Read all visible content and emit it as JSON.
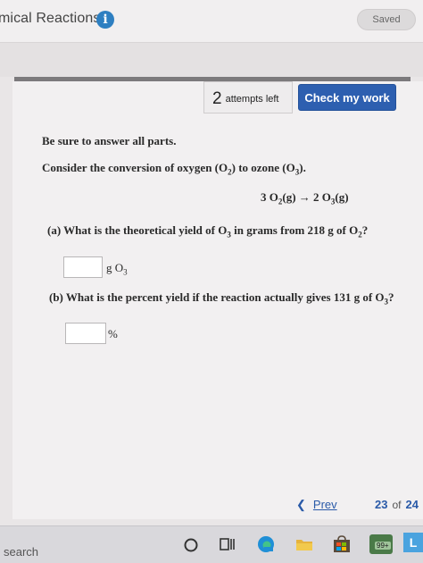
{
  "header": {
    "title": "mical Reactions",
    "info_icon": "info-icon",
    "saved_label": "Saved"
  },
  "toolbar": {
    "attempts_count": "2",
    "attempts_label": "attempts left",
    "check_button": "Check my work"
  },
  "question": {
    "instruction": "Be sure to answer all parts.",
    "prompt_parts": [
      "Consider the conversion of oxygen (O",
      "2",
      ") to ozone (O",
      "3",
      ")."
    ],
    "equation_parts": [
      "3 O",
      "2",
      "(g) → 2 O",
      "3",
      "(g)"
    ],
    "part_a_parts": [
      "(a) What is the theoretical yield of O",
      "3",
      " in grams from 218 g of O",
      "2",
      "?"
    ],
    "part_a_unit_parts": [
      "g O",
      "3"
    ],
    "part_a_value": "",
    "part_b_parts": [
      "(b) What is the percent yield if the reaction actually gives 131 g of O",
      "3",
      "?"
    ],
    "part_b_unit": "%",
    "part_b_value": ""
  },
  "navigation": {
    "prev_label": "Prev",
    "current_page": "23",
    "of_label": "of",
    "total_pages": "24"
  },
  "taskbar": {
    "search_label": "search",
    "icons": [
      "cortana-icon",
      "task-view-icon",
      "edge-icon",
      "file-explorer-icon",
      "store-icon",
      "notification-badge-icon",
      "app-icon"
    ],
    "badge": "99+"
  },
  "colors": {
    "accent": "#2d5fb0",
    "info": "#2e7fc1",
    "link": "#2a5aa8"
  }
}
